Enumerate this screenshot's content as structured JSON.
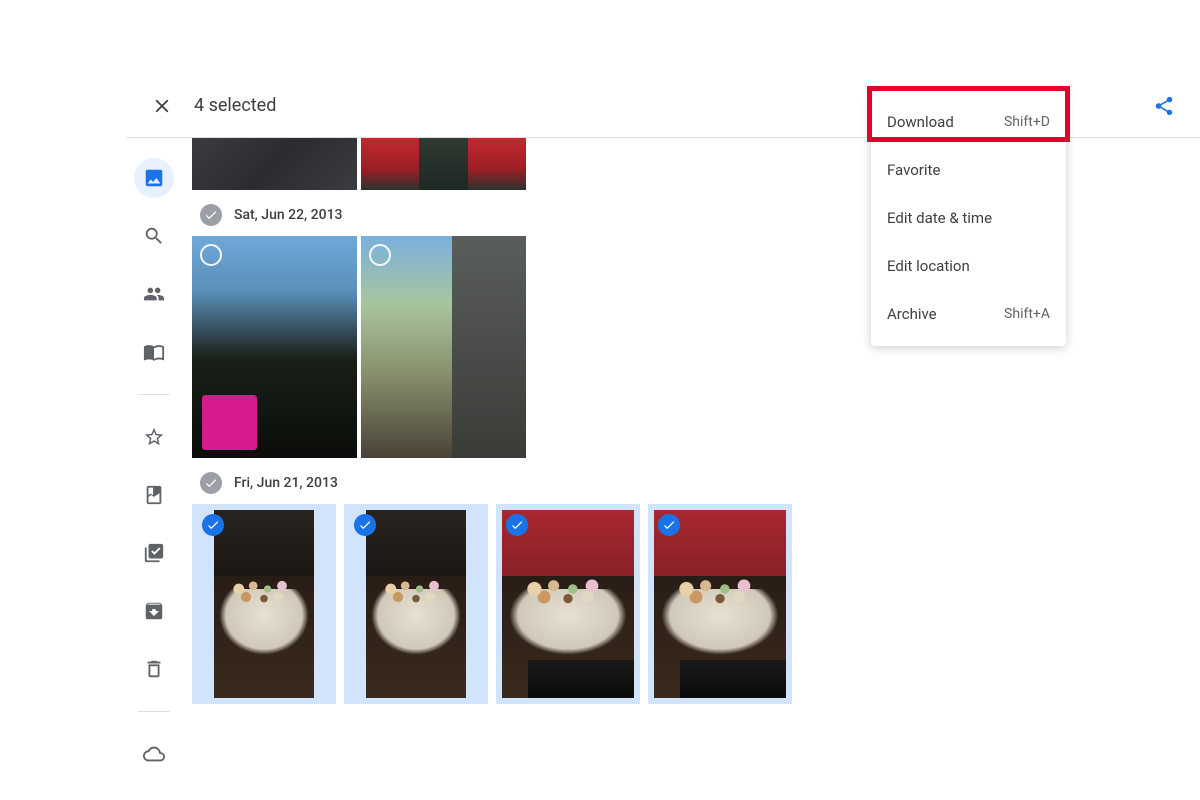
{
  "topbar": {
    "selection_text": "4 selected"
  },
  "dates": {
    "group1": "Sat, Jun 22, 2013",
    "group2": "Fri, Jun 21, 2013"
  },
  "menu": {
    "download": {
      "label": "Download",
      "shortcut": "Shift+D"
    },
    "favorite": {
      "label": "Favorite"
    },
    "edit_date": {
      "label": "Edit date & time"
    },
    "edit_location": {
      "label": "Edit location"
    },
    "archive": {
      "label": "Archive",
      "shortcut": "Shift+A"
    }
  }
}
